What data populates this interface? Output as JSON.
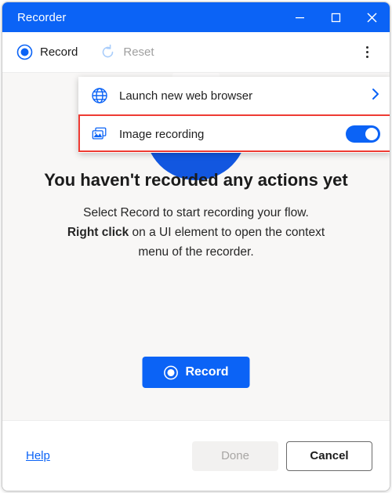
{
  "window": {
    "title": "Recorder",
    "controls": [
      {
        "name": "minimize",
        "glyph": "minimize-icon"
      },
      {
        "name": "maximize",
        "glyph": "maximize-icon"
      },
      {
        "name": "close",
        "glyph": "close-icon"
      }
    ]
  },
  "toolbar": {
    "record_label": "Record",
    "record_icon": "record-circle-icon",
    "reset_label": "Reset",
    "reset_icon": "reset-arrow-icon",
    "overflow_icon": "kebab-menu-icon"
  },
  "menu": {
    "items": [
      {
        "label": "Launch new web browser",
        "icon": "globe-icon",
        "trailing": "chevron-right-icon",
        "highlighted": false
      },
      {
        "label": "Image recording",
        "icon": "images-icon",
        "trailing": "toggle-switch-on",
        "highlighted": true,
        "toggle_state": "on"
      }
    ]
  },
  "main": {
    "illustration_icon": "record-screen-illustration",
    "headline": "You haven't recorded any actions yet",
    "sub_line1": "Select Record to start recording your flow.",
    "sub_line2_bold": "Right click",
    "sub_line2_rest": " on a UI element to open the context",
    "sub_line3": "menu of the recorder.",
    "record_button_label": "Record",
    "record_button_icon": "record-circle-icon"
  },
  "footer": {
    "help_label": "Help",
    "done_label": "Done",
    "cancel_label": "Cancel"
  },
  "colors": {
    "accent": "#0b63f6",
    "title_bar": "#0b63f6",
    "content_bg": "#f8f7f6",
    "highlight_border": "#ee3b33",
    "disabled_text": "#a8a6a4",
    "illustration_disc": "#1257e0"
  }
}
